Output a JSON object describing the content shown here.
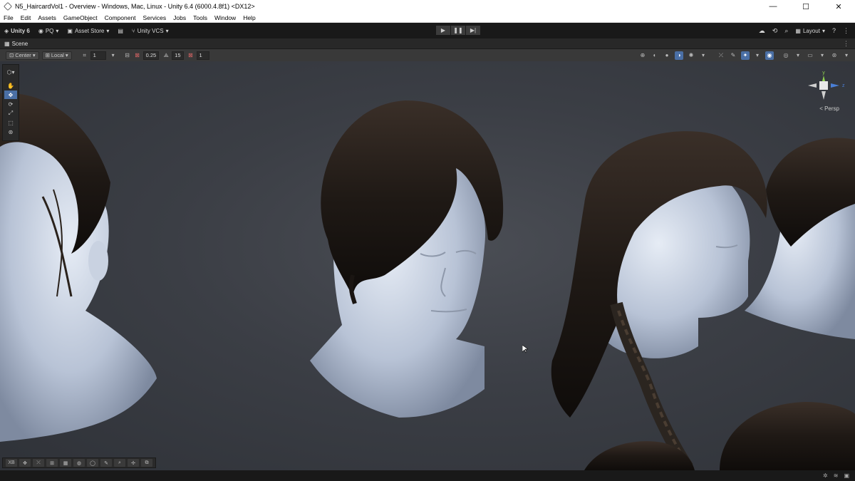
{
  "window": {
    "title": "N5_HaircardVol1 - Overview - Windows, Mac, Linux - Unity 6.4 (6000.4.8f1) <DX12>",
    "controls": {
      "minimize": "—",
      "maximize": "☐",
      "close": "✕"
    }
  },
  "menu": [
    "File",
    "Edit",
    "Assets",
    "GameObject",
    "Component",
    "Services",
    "Jobs",
    "Tools",
    "Window",
    "Help"
  ],
  "toolbar": {
    "unity_label": "Unity 6",
    "account_label": "PQ",
    "asset_store_label": "Asset Store",
    "vcs_label": "Unity VCS",
    "layout_label": "Layout"
  },
  "scene_tab": {
    "label": "Scene"
  },
  "overlay": {
    "pivot_label": "Center",
    "space_label": "Local",
    "grid_value": "1",
    "snap_value": "0.25",
    "rotate_snap_value": "15",
    "scale_snap_value": "1"
  },
  "gizmo": {
    "persp_label": "< Persp",
    "y_axis": "y",
    "z_axis": "z"
  },
  "bottom_toolbar": {
    "xb_label": "XB"
  },
  "accent_color": "#4a6fa5"
}
